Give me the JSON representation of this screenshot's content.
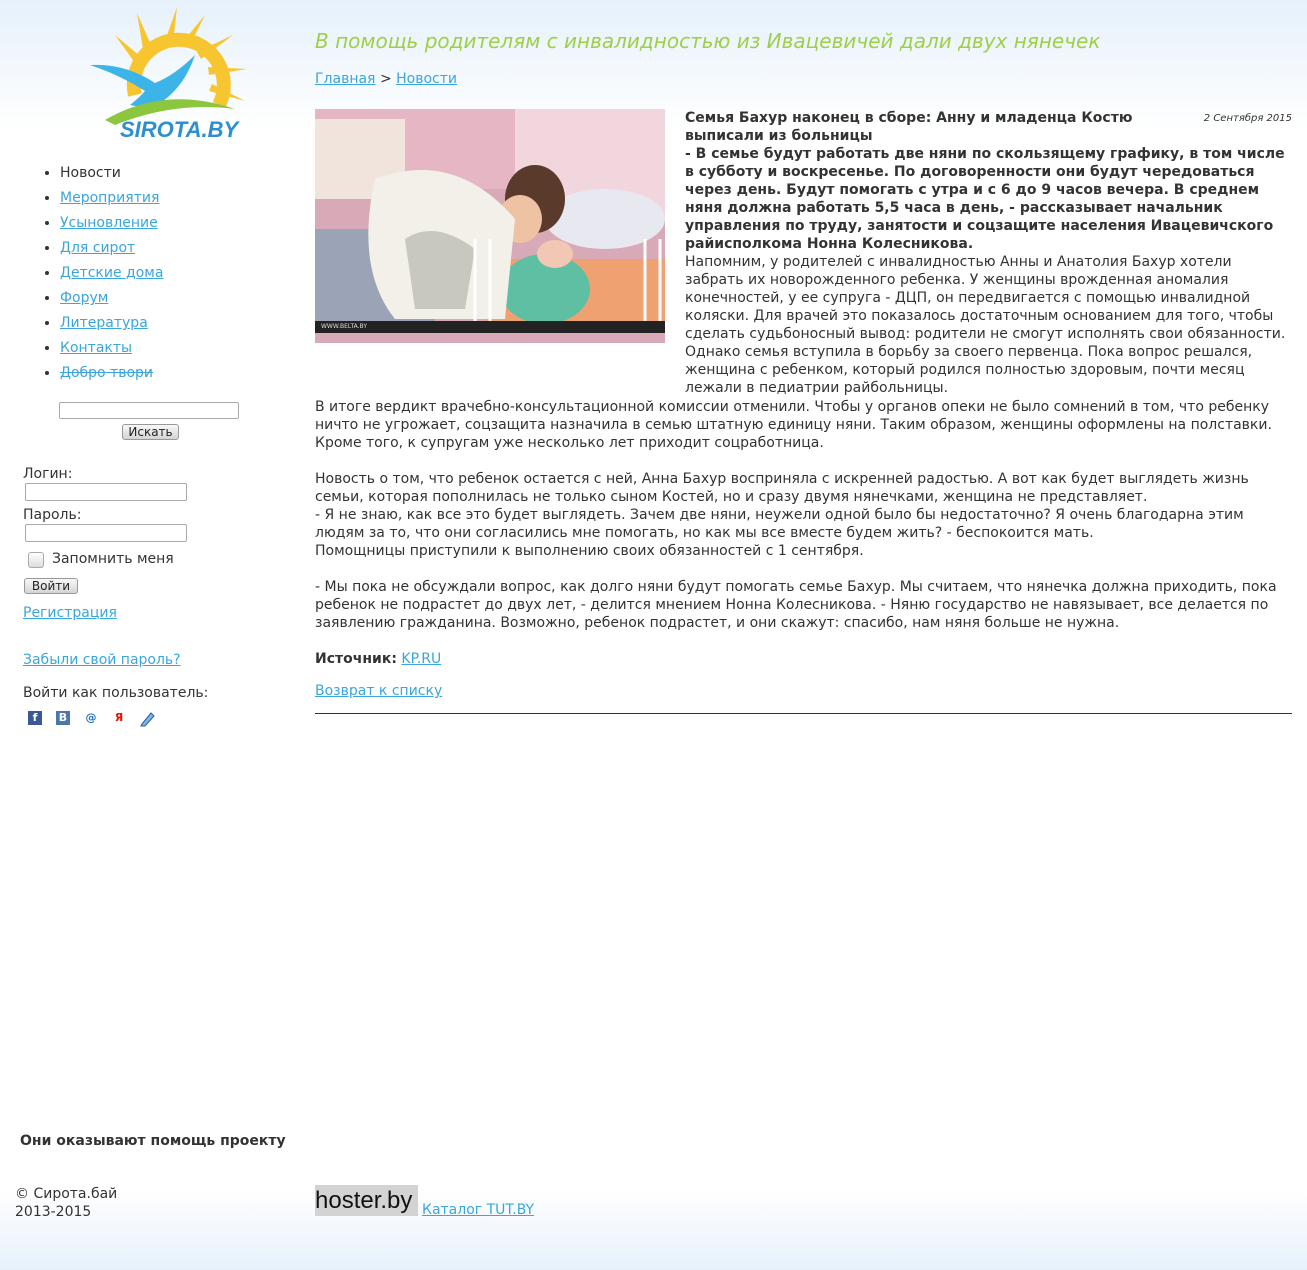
{
  "site": {
    "logo_text": "SIROTA.BY"
  },
  "nav": {
    "items": [
      {
        "label": "Новости"
      },
      {
        "label": "Мероприятия"
      },
      {
        "label": "Усыновление"
      },
      {
        "label": "Для сирот"
      },
      {
        "label": "Детские дома"
      },
      {
        "label": "Форум"
      },
      {
        "label": "Литература"
      },
      {
        "label": "Контакты"
      },
      {
        "label": "Добро твори"
      }
    ]
  },
  "search": {
    "button_label": "Искать",
    "value": ""
  },
  "auth": {
    "login_label": "Логин:",
    "password_label": "Пароль:",
    "remember_label": "Запомнить меня",
    "submit_label": "Войти",
    "register_link": "Регистрация",
    "forgot_link": "Забыли свой пароль?",
    "social_label": "Войти как пользователь:",
    "social_icons": [
      "facebook-icon",
      "vkontakte-icon",
      "mailru-icon",
      "yandex-icon",
      "openid-icon"
    ]
  },
  "article": {
    "title": "В помощь родителям с инвалидностью из Ивацевичей дали двух нянечек",
    "breadcrumb": {
      "home": "Главная",
      "separator": ">",
      "section": "Новости"
    },
    "date": "2 Сентября 2015",
    "photo_watermark": "WWW.BELTA.BY",
    "intro_line1": "Семья Бахур наконец в сборе: Анну и младенца Костю выписали из больницы",
    "intro_rest": "- В семье будут работать две няни по скользящему графику, в том числе в субботу и воскресенье. По договоренности они будут чередоваться через день. Будут помогать с утра и с 6 до 9 часов вечера. В среднем няня должна работать 5,5 часа в день, - рассказывает начальник управления по труду, занятости и соцзащите населения Ивацевичского райисполкома Нонна Колесникова.",
    "para1": "Напомним, у родителей с инвалидностью Анны и Анатолия Бахур хотели забрать их новорожденного ребенка. У женщины врожденная аномалия конечностей, у ее супруга - ДЦП, он передвигается с помощью инвалидной коляски. Для врачей это показалось достаточным основанием для того, чтобы сделать судьбоносный вывод: родители не смогут исполнять свои обязанности. Однако семья вступила в борьбу за своего первенца. Пока вопрос решался, женщина с ребенком, который родился полностью здоровым, почти месяц лежали в педиатрии райбольницы.",
    "para2": "В итоге вердикт врачебно-консультационной комиссии отменили. Чтобы у органов опеки не было сомнений в том, что ребенку ничто не угрожает, соцзащита назначила в семью штатную единицу няни. Таким образом, женщины оформлены на полставки. Кроме того, к супругам уже несколько лет приходит соцработница.",
    "para3_a": "Новость о том, что ребенок остается с ней, Анна Бахур восприняла с искренней радостью. А вот как будет выглядеть жизнь семьи, которая пополнилась не только сыном Костей, но и сразу двумя нянечками, женщина не представляет.",
    "para3_b": "- Я не знаю, как все это будет выглядеть. Зачем две няни, неужели одной было бы недостаточно? Я очень благодарна этим людям за то, что они согласились мне помогать, но как мы все вместе будем жить? - беспокоится мать.",
    "para3_c": "Помощницы приступили к выполнению своих обязанностей с 1 сентября.",
    "para4": "- Мы пока не обсуждали вопрос, как долго няни будут помогать семье Бахур. Мы считаем, что нянечка должна приходить, пока ребенок не подрастет до двух лет, - делится мнением Нонна Колесникова. - Няню государство не навязывает, все делается по заявлению гражданина. Возможно, ребенок подрастет, и они скажут: спасибо, нам няня больше не нужна.",
    "source_label": "Источник:",
    "source_link": "KP.RU",
    "back_link": "Возврат к списку"
  },
  "footer": {
    "helpers_title": "Они оказывают помощь проекту",
    "copyright_line1": "© Сирота.бай",
    "copyright_line2": "2013-2015",
    "hoster_logo": "hoster.by",
    "catalog_link": "Каталог TUT.BY"
  }
}
